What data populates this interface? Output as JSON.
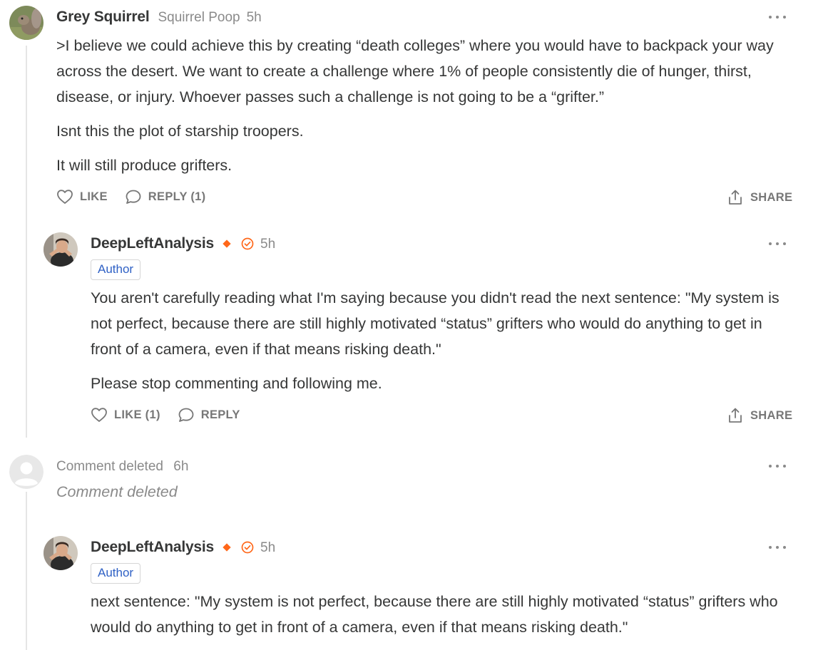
{
  "comments": [
    {
      "author": "Grey Squirrel",
      "subname": "Squirrel Poop",
      "time": "5h",
      "paragraphs": [
        ">I believe we could achieve this by creating “death colleges” where you would have to backpack your way across the desert. We want to create a challenge where 1% of people consistently die of hunger, thirst, disease, or injury. Whoever passes such a challenge is not going to be a “grifter.”",
        "Isnt this the plot of starship troopers.",
        "It will still produce grifters."
      ],
      "like_label": "LIKE",
      "reply_label": "REPLY (1)",
      "share_label": "SHARE"
    },
    {
      "author": "DeepLeftAnalysis",
      "time": "5h",
      "badge": "Author",
      "paragraphs": [
        "You aren't carefully reading what I'm saying because you didn't read the next sentence: \"My system is not perfect, because there are still highly motivated “status” grifters who would do anything to get in front of a camera, even if that means risking death.\"",
        "Please stop commenting and following me."
      ],
      "like_label": "LIKE (1)",
      "reply_label": "REPLY",
      "share_label": "SHARE"
    },
    {
      "meta": "Comment deleted",
      "time": "6h",
      "body": "Comment deleted"
    },
    {
      "author": "DeepLeftAnalysis",
      "time": "5h",
      "badge": "Author",
      "paragraphs": [
        "next sentence: \"My system is not perfect, because there are still highly motivated “status” grifters who would do anything to get in front of a camera, even if that means risking death.\""
      ]
    }
  ],
  "colors": {
    "accent": "#ff6719",
    "author_badge_text": "#2f61c5",
    "text": "#363737",
    "muted": "#8a8a8a"
  },
  "icons": {
    "like": "heart-icon",
    "reply": "speech-bubble-icon",
    "share": "share-icon",
    "more": "ellipsis-icon",
    "verified": "check-circle-icon",
    "diamond": "diamond-icon"
  }
}
